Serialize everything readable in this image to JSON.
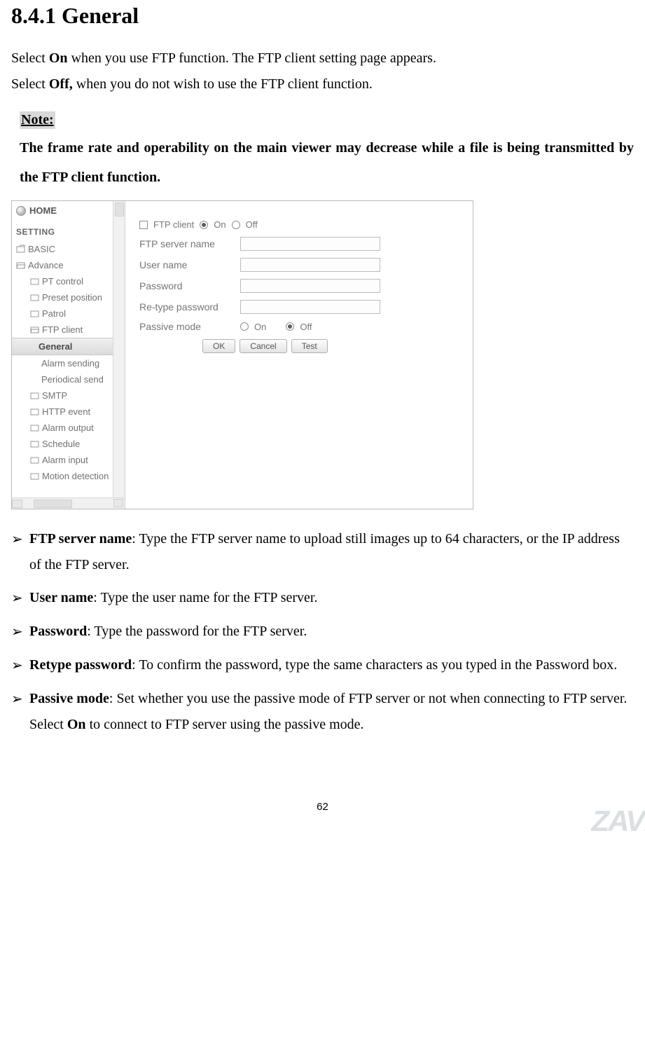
{
  "heading": "8.4.1 General",
  "intro1_pre": "Select ",
  "intro1_b": "On",
  "intro1_post": " when you use FTP function. The FTP client setting page appears.",
  "intro2_pre": "Select ",
  "intro2_b": "Off,",
  "intro2_post": " when you do not wish to use the FTP client function.",
  "note_label": "Note:",
  "note_text": "The frame rate and operability on the main viewer may decrease while a file is being transmitted by the FTP client function.",
  "screenshot": {
    "home": "HOME",
    "setting": "SETTING",
    "tree": {
      "basic": "BASIC",
      "advance": "Advance",
      "pt_control": "PT control",
      "preset_position": "Preset position",
      "patrol": "Patrol",
      "ftp_client": "FTP client",
      "general": "General",
      "alarm_sending": "Alarm sending",
      "periodical_send": "Periodical send",
      "smtp": "SMTP",
      "http_event": "HTTP event",
      "alarm_output": "Alarm output",
      "schedule": "Schedule",
      "alarm_input": "Alarm input",
      "motion_detection": "Motion detection"
    },
    "form": {
      "ftp_client": "FTP client",
      "on": "On",
      "off": "Off",
      "ftp_server_name": "FTP server name",
      "user_name": "User name",
      "password": "Password",
      "retype_password": "Re-type password",
      "passive_mode": "Passive mode",
      "ok": "OK",
      "cancel": "Cancel",
      "test": "Test"
    }
  },
  "bullets": {
    "b1_label": "FTP server name",
    "b1_text": ": Type the FTP server name to upload still images up to 64 characters, or the IP address of the FTP server.",
    "b2_label": "User name",
    "b2_text": ": Type the user name for the FTP server.",
    "b3_label": "Password",
    "b3_text": ": Type the password for the FTP server.",
    "b4_label": "Retype password",
    "b4_text": ": To confirm the password, type the same characters as you typed in the Password box.",
    "b5_label": "Passive mode",
    "b5_text1": ": Set whether you use the passive mode of FTP server or not when connecting to FTP server. Select ",
    "b5_text_b": "On",
    "b5_text2": " to connect to FTP server using the passive mode."
  },
  "page_number": "62",
  "watermark": "ZAVI"
}
